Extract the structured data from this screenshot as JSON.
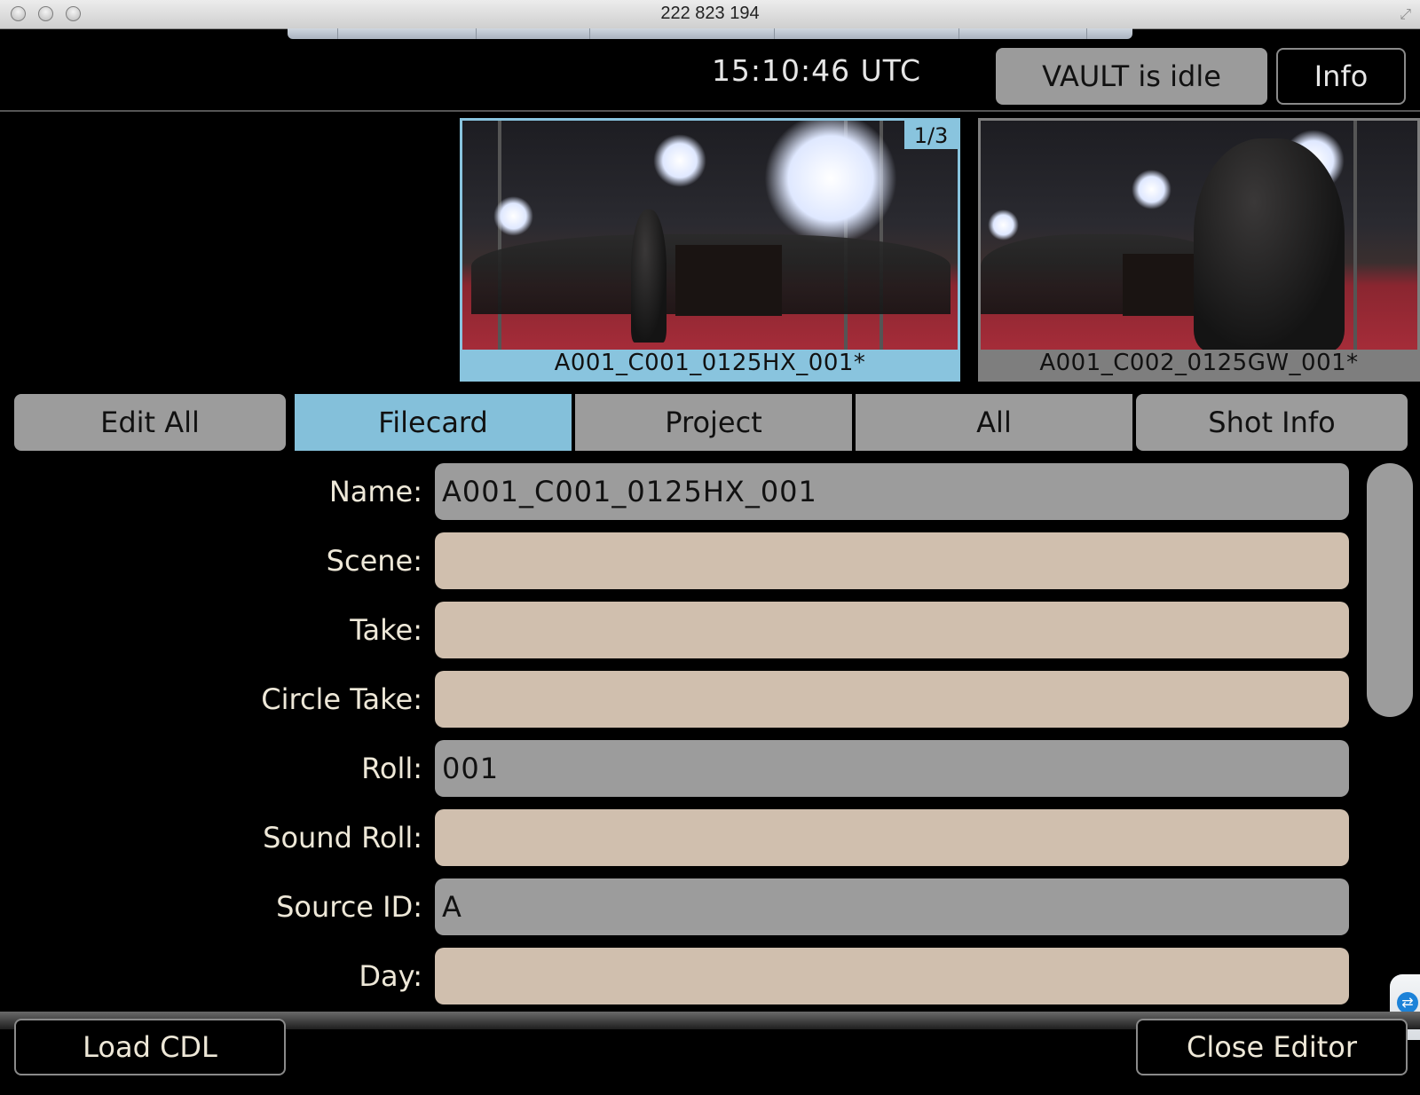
{
  "window": {
    "title": "222 823 194"
  },
  "header": {
    "clock": "15:10:46 UTC",
    "status": "VAULT is idle",
    "info_label": "Info"
  },
  "thumbnails": {
    "page_indicator": "1/3",
    "items": [
      {
        "caption": "A001_C001_0125HX_001*",
        "selected": true
      },
      {
        "caption": "A001_C002_0125GW_001*",
        "selected": false
      }
    ]
  },
  "tabs": [
    {
      "label": "Edit All",
      "active": false
    },
    {
      "label": "Filecard",
      "active": true
    },
    {
      "label": "Project",
      "active": false
    },
    {
      "label": "All",
      "active": false
    },
    {
      "label": "Shot Info",
      "active": false
    }
  ],
  "form": {
    "fields": [
      {
        "label": "Name:",
        "value": "A001_C001_0125HX_001",
        "editable": false
      },
      {
        "label": "Scene:",
        "value": "",
        "editable": true
      },
      {
        "label": "Take:",
        "value": "",
        "editable": true
      },
      {
        "label": "Circle Take:",
        "value": "",
        "editable": true
      },
      {
        "label": "Roll:",
        "value": "001",
        "editable": false
      },
      {
        "label": "Sound Roll:",
        "value": "",
        "editable": true
      },
      {
        "label": "Source ID:",
        "value": "A",
        "editable": false
      },
      {
        "label": "Day:",
        "value": "",
        "editable": true
      }
    ]
  },
  "footer": {
    "load_cdl_label": "Load CDL",
    "close_editor_label": "Close Editor"
  },
  "colors": {
    "active_tab": "#84c0da",
    "inactive_tab": "#9c9c9c",
    "editable_field": "#d0bfae",
    "readonly_field": "#9c9c9c"
  }
}
